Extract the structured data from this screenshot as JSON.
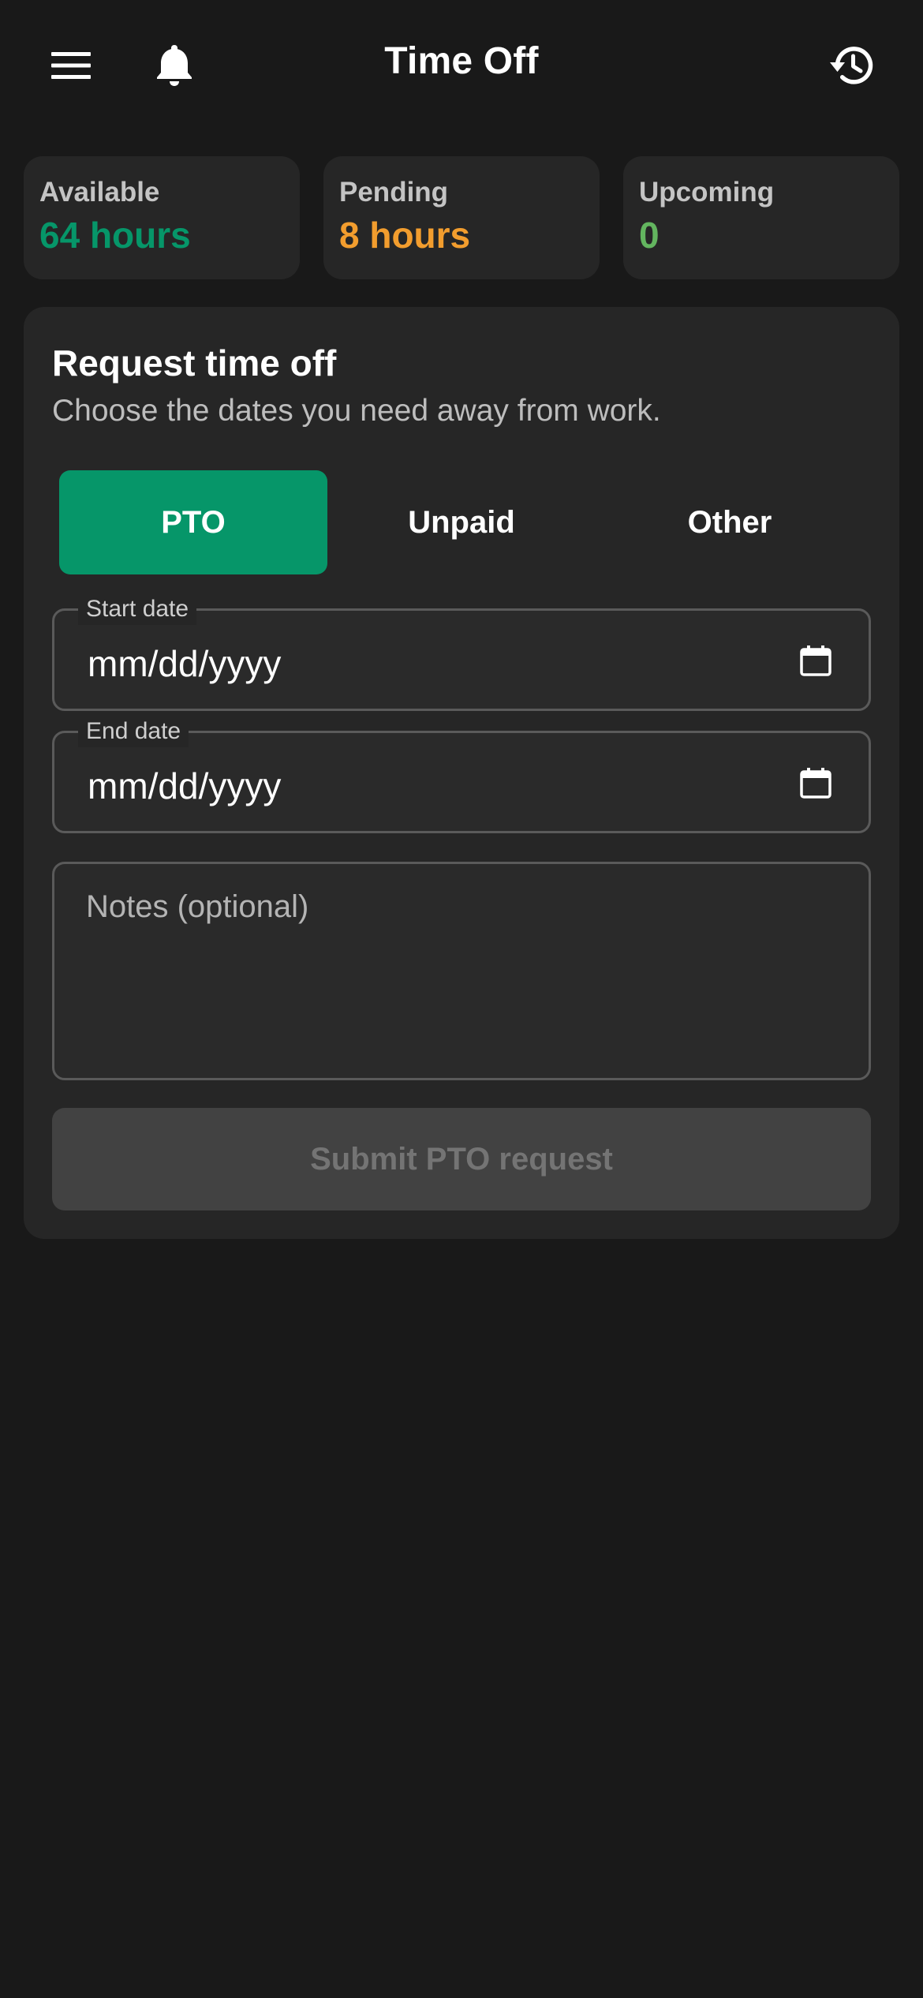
{
  "header": {
    "title": "Time Off",
    "menu_icon": "menu-icon",
    "bell_icon": "bell-icon",
    "history_icon": "history-icon"
  },
  "stats": [
    {
      "label": "Available",
      "value": "64 hours",
      "color": "#069669"
    },
    {
      "label": "Pending",
      "value": "8 hours",
      "color": "#f29d2e"
    },
    {
      "label": "Upcoming",
      "value": "0",
      "color": "#63b55f"
    }
  ],
  "request": {
    "title": "Request time off",
    "subtitle": "Choose the dates you need away from work.",
    "tabs": [
      {
        "label": "PTO",
        "active": true
      },
      {
        "label": "Unpaid",
        "active": false
      },
      {
        "label": "Other",
        "active": false
      }
    ],
    "start_date": {
      "label": "Start date",
      "value": "mm/dd/yyyy"
    },
    "end_date": {
      "label": "End date",
      "value": "mm/dd/yyyy"
    },
    "notes": {
      "placeholder": "Notes (optional)"
    },
    "submit_label": "Submit PTO request"
  },
  "colors": {
    "background": "#191919",
    "card": "#262626",
    "accent": "#069669"
  }
}
